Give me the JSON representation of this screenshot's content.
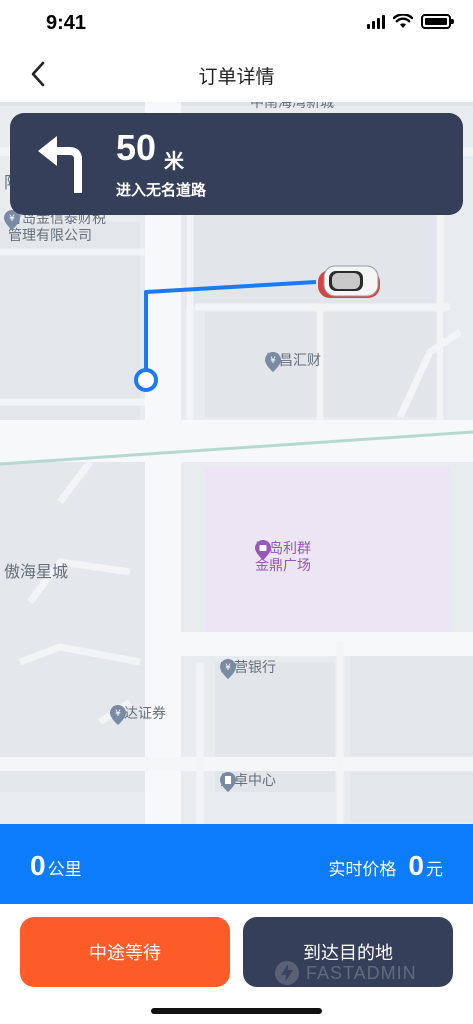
{
  "status_bar": {
    "time": "9:41"
  },
  "nav": {
    "title": "订单详情",
    "back_icon": "chevron-left-icon"
  },
  "map": {
    "labels": {
      "top_cut": "中南海湾新城",
      "left_cut": "际",
      "poi_1_line1": "青岛金信泰财税",
      "poi_1_line2": "管理有限公司",
      "poi_hengchang": "恒昌汇财",
      "poi_mall_line1": "青岛利群",
      "poi_mall_line2": "金鼎广场",
      "poi_aohai": "傲海星城",
      "poi_bank": "东营银行",
      "poi_xinda": "信达证券",
      "poi_heizhuo": "黑卓中心"
    },
    "colors": {
      "route": "#1a7bf5",
      "mall_area": "#ece5f3"
    }
  },
  "navigation": {
    "distance": "50",
    "unit": "米",
    "road": "进入无名道路",
    "icon": "turn-left-icon"
  },
  "stats": {
    "distance_value": "0",
    "distance_unit": "公里",
    "price_label": "实时价格",
    "price_value": "0",
    "price_unit": "元"
  },
  "actions": {
    "wait_label": "中途等待",
    "arrive_label": "到达目的地"
  },
  "watermark": {
    "text": "FASTADMIN",
    "icon": "bolt-icon"
  },
  "colors": {
    "card_bg": "#363f59",
    "info_bar": "#0d7cfb",
    "wait_button": "#fd5c29",
    "arrive_button": "#363f59"
  }
}
